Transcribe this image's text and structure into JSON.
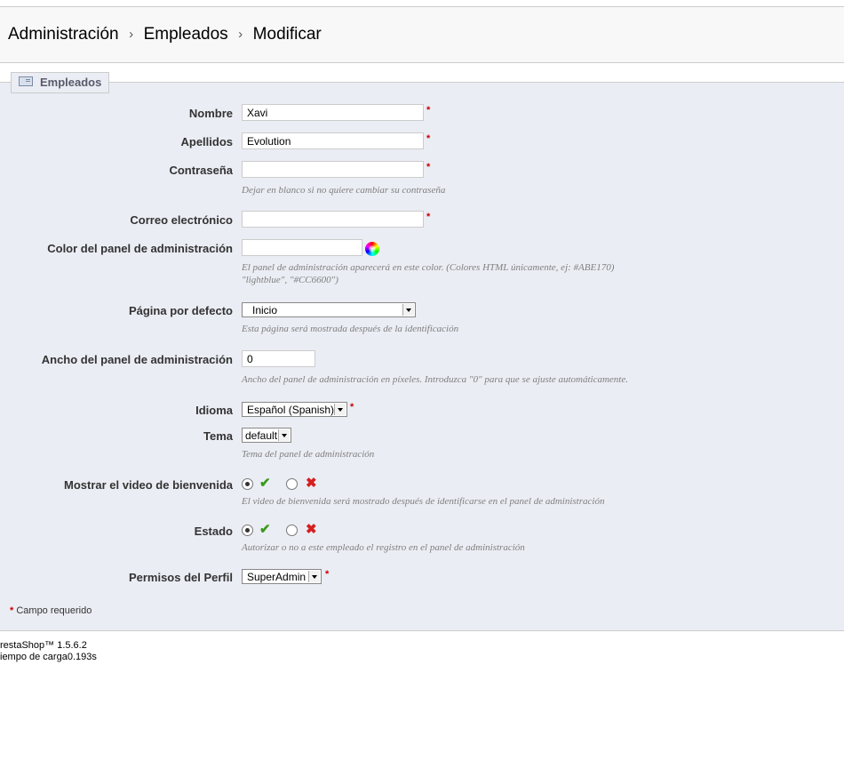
{
  "breadcrumb": [
    "Administración",
    "Empleados",
    "Modificar"
  ],
  "breadcrumb_sep": "›",
  "legend": {
    "label": "Empleados",
    "icon": "employee-card-icon"
  },
  "fields": {
    "nombre": {
      "label": "Nombre",
      "value": "Xavi"
    },
    "apellidos": {
      "label": "Apellidos",
      "value": "Evolution"
    },
    "contrasena": {
      "label": "Contraseña",
      "value": "",
      "help": "Dejar en blanco si no quiere cambiar su contraseña"
    },
    "correo": {
      "label": "Correo electrónico",
      "value": ""
    },
    "color": {
      "label": "Color del panel de administración",
      "value": "",
      "help_line1": "El panel de administración aparecerá en este color. (Colores HTML únicamente, ej: #ABE170)",
      "help_line2": "\"lightblue\", \"#CC6600\")",
      "icon": "color-wheel-icon"
    },
    "pagina": {
      "label": "Página por defecto",
      "value": "Inicio",
      "help": "Esta página será mostrada después de la identificación"
    },
    "ancho": {
      "label": "Ancho del panel de administración",
      "value": "0",
      "help": "Ancho del panel de administración en píxeles. Introduzca \"0\" para que se ajuste automáticamente."
    },
    "idioma": {
      "label": "Idioma",
      "value": "Español (Spanish)"
    },
    "tema": {
      "label": "Tema",
      "value": "default",
      "help": "Tema del panel de administración"
    },
    "video": {
      "label": "Mostrar el video de bienvenida",
      "selected": "yes",
      "help": "El video de bienvenida será mostrado después de identificarse en el panel de administración"
    },
    "estado": {
      "label": "Estado",
      "selected": "yes",
      "help": "Autorizar o no a este empleado el registro en el panel de administración"
    },
    "permisos": {
      "label": "Permisos del Perfil",
      "value": "SuperAdmin"
    }
  },
  "required_marker": "*",
  "required_note": "Campo requerido",
  "yes_icon": "✔",
  "no_icon": "✖",
  "footer": {
    "version": "restaShop™ 1.5.6.2",
    "load_time": "iempo de carga0.193s"
  },
  "colors": {
    "required": "#cc0000",
    "panel_bg": "#ebedf4",
    "yes": "#3a9a1e",
    "no": "#d42020"
  }
}
